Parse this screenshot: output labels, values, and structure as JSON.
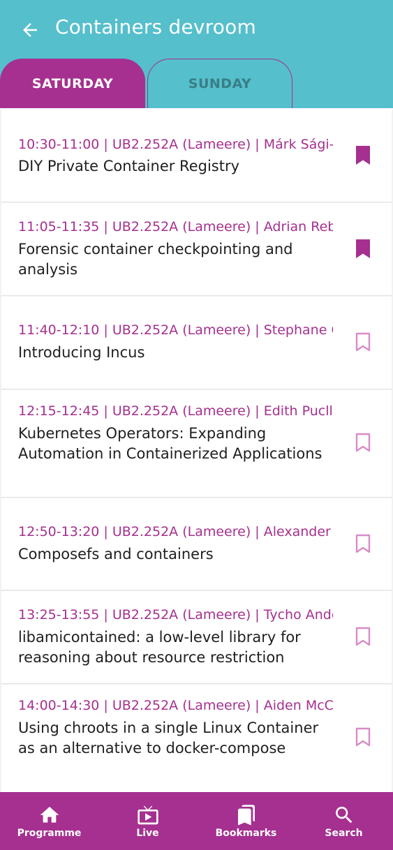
{
  "header": {
    "title": "Containers devroom",
    "back_icon": "arrow-left-icon"
  },
  "tabs": [
    {
      "label": "SATURDAY",
      "selected": true
    },
    {
      "label": "SUNDAY",
      "selected": false
    }
  ],
  "events": [
    {
      "meta": "10:30-11:00 | UB2.252A (Lameere) | Márk Sági-Kazár",
      "title": "DIY Private Container Registry",
      "bookmarked": true
    },
    {
      "meta": "11:05-11:35 | UB2.252A (Lameere) | Adrian Reber",
      "title": "Forensic container checkpointing and analysis",
      "bookmarked": true
    },
    {
      "meta": "11:40-12:10 | UB2.252A (Lameere) | Stephane Graber",
      "title": "Introducing Incus",
      "bookmarked": false
    },
    {
      "meta": "12:15-12:45 | UB2.252A (Lameere) | Edith Puclla",
      "title": "Kubernetes Operators: Expanding Automation in Containerized Applications",
      "bookmarked": false
    },
    {
      "meta": "12:50-13:20 | UB2.252A (Lameere) | Alexander Larsson",
      "title": "Composefs and containers",
      "bookmarked": false
    },
    {
      "meta": "13:25-13:55 | UB2.252A (Lameere) | Tycho Andersen",
      "title": "libamicontained: a low-level library for reasoning about resource restriction",
      "bookmarked": false
    },
    {
      "meta": "14:00-14:30 | UB2.252A (Lameere) | Aiden McClelland",
      "title": "Using chroots in a single Linux Container as an alternative to docker-compose",
      "bookmarked": false
    }
  ],
  "bottom_nav": [
    {
      "label": "Programme",
      "icon": "home-icon"
    },
    {
      "label": "Live",
      "icon": "tv-icon"
    },
    {
      "label": "Bookmarks",
      "icon": "bookmarks-icon"
    },
    {
      "label": "Search",
      "icon": "search-icon"
    }
  ],
  "colors": {
    "primary": "#a5308f",
    "header": "#55bfcc",
    "bookmark_inactive": "#d98bc8"
  }
}
